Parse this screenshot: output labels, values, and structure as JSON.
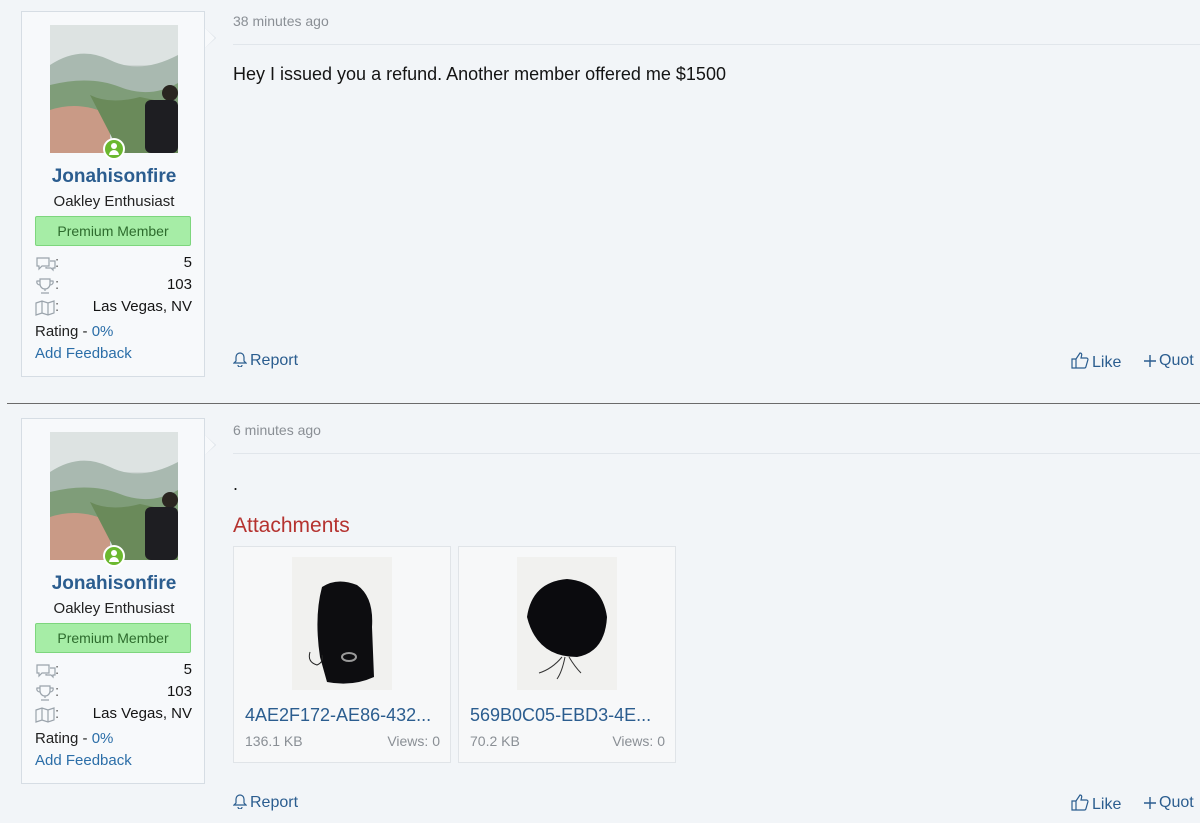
{
  "posts": [
    {
      "user": {
        "username": "Jonahisonfire",
        "title": "Oakley Enthusiast",
        "banner": "Premium Member",
        "messages": "5",
        "points": "103",
        "location": "Las Vegas, NV",
        "rating_label": "Rating - ",
        "rating_value": "0%",
        "feedback_link": "Add Feedback",
        "stat_colon": ":"
      },
      "time": "38 minutes ago",
      "message": "Hey I issued you a refund. Another member offered me $1500",
      "actions": {
        "report": "Report",
        "like": "Like",
        "quote": "Quot"
      }
    },
    {
      "user": {
        "username": "Jonahisonfire",
        "title": "Oakley Enthusiast",
        "banner": "Premium Member",
        "messages": "5",
        "points": "103",
        "location": "Las Vegas, NV",
        "rating_label": "Rating - ",
        "rating_value": "0%",
        "feedback_link": "Add Feedback",
        "stat_colon": ":"
      },
      "time": "6 minutes ago",
      "message": ".",
      "attachments_title": "Attachments",
      "attachments": [
        {
          "name": "4AE2F172-AE86-432...",
          "size": "136.1 KB",
          "views": "Views: 0"
        },
        {
          "name": "569B0C05-EBD3-4E...",
          "size": "70.2 KB",
          "views": "Views: 0"
        }
      ],
      "actions": {
        "report": "Report",
        "like": "Like",
        "quote": "Quot"
      }
    }
  ],
  "colors": {
    "link": "#2b5d8f",
    "banner_bg": "#a6eda6",
    "online": "#6bb82f",
    "attachments_heading": "#b5322f"
  },
  "icons": {
    "messages": "chat-bubbles-icon",
    "points": "trophy-icon",
    "location": "map-icon",
    "report": "bell-icon",
    "like": "thumbs-up-icon",
    "quote": "plus-icon",
    "online": "user-online-icon"
  }
}
